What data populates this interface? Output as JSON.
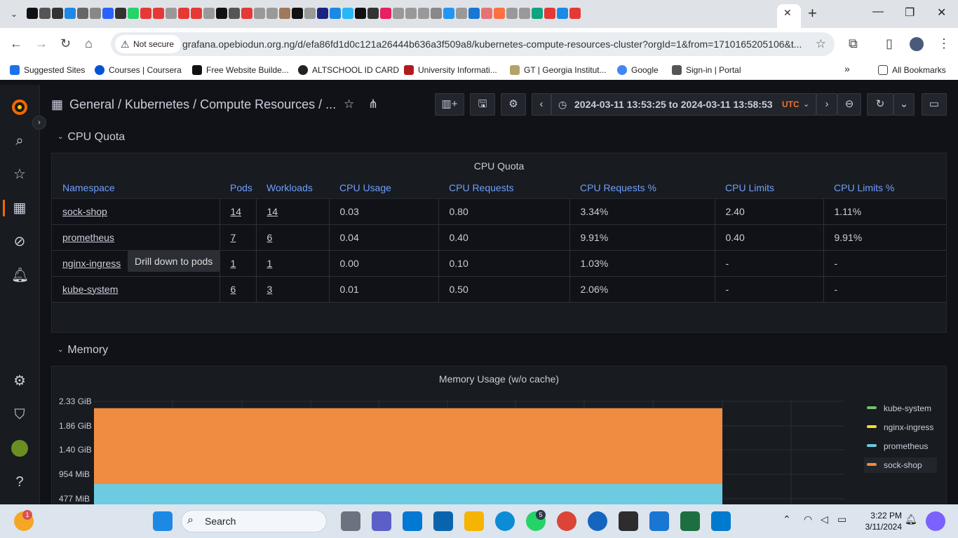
{
  "browser": {
    "not_secure": "Not secure",
    "url": "grafana.opebiodun.org.ng/d/efa86fd1d0c121a26444b636a3f509a8/kubernetes-compute-resources-cluster?orgId=1&from=1710165205106&t...",
    "bookmarks": [
      {
        "label": "Suggested Sites",
        "color": "#1a73e8"
      },
      {
        "label": "Courses | Coursera",
        "color": "#0056d2"
      },
      {
        "label": "Free Website Builde...",
        "color": "#111111"
      },
      {
        "label": "ALTSCHOOL ID CARD",
        "color": "#222222"
      },
      {
        "label": "University Informati...",
        "color": "#b31b1b"
      },
      {
        "label": "GT | Georgia Institut...",
        "color": "#b3a369"
      },
      {
        "label": "Google",
        "color": "#4285f4"
      },
      {
        "label": "Sign-in | Portal",
        "color": "#555555"
      }
    ],
    "all_bookmarks": "All Bookmarks"
  },
  "grafana": {
    "breadcrumb": "General  / Kubernetes / Compute Resources / ...",
    "time_range": "2024-03-11 13:53:25 to 2024-03-11 13:58:53",
    "timezone": "UTC",
    "rows": {
      "cpu": "CPU Quota",
      "memory": "Memory"
    },
    "cpu_panel": {
      "title": "CPU Quota",
      "columns": [
        "Namespace",
        "Pods",
        "Workloads",
        "CPU Usage",
        "CPU Requests",
        "CPU Requests %",
        "CPU Limits",
        "CPU Limits %"
      ],
      "rows": [
        [
          "sock-shop",
          "14",
          "14",
          "0.03",
          "0.80",
          "3.34%",
          "2.40",
          "1.11%"
        ],
        [
          "prometheus",
          "7",
          "6",
          "0.04",
          "0.40",
          "9.91%",
          "0.40",
          "9.91%"
        ],
        [
          "nginx-ingress",
          "1",
          "1",
          "0.00",
          "0.10",
          "1.03%",
          "-",
          "-"
        ],
        [
          "kube-system",
          "6",
          "3",
          "0.01",
          "0.50",
          "2.06%",
          "-",
          "-"
        ]
      ],
      "tooltip": "Drill down to pods"
    },
    "memory_panel": {
      "title": "Memory Usage (w/o cache)"
    }
  },
  "chart_data": {
    "type": "area",
    "title": "Memory Usage (w/o cache)",
    "y_ticks": [
      "2.33 GiB",
      "1.86 GiB",
      "1.40 GiB",
      "954 MiB",
      "477 MiB"
    ],
    "series": [
      {
        "name": "kube-system",
        "color": "#73bf69",
        "value_gib": 0.0
      },
      {
        "name": "nginx-ingress",
        "color": "#fade2a",
        "value_gib": 0.0
      },
      {
        "name": "prometheus",
        "color": "#6ccbe0",
        "value_gib": 0.75
      },
      {
        "name": "sock-shop",
        "color": "#f08c42",
        "value_gib": 1.45
      }
    ],
    "legend_position": "right",
    "stacked": true
  },
  "taskbar": {
    "search": "Search",
    "time": "3:22 PM",
    "date": "3/11/2024",
    "whatsapp_badge": "5",
    "weather_badge": "1"
  }
}
